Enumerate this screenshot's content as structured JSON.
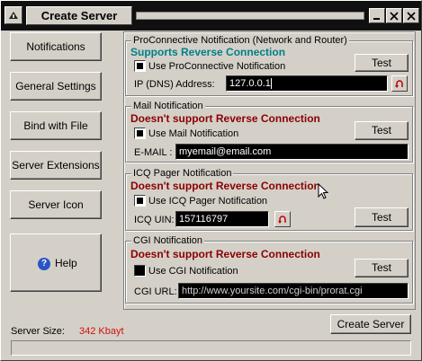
{
  "window": {
    "title": "Create Server"
  },
  "nav": {
    "notifications": "Notifications",
    "general_settings": "General Settings",
    "bind_with_file": "Bind with File",
    "server_extensions": "Server Extensions",
    "server_icon": "Server Icon",
    "help": "Help"
  },
  "proconnective": {
    "group_label": "ProConnective Notification (Network and Router)",
    "status": "Supports Reverse Connection",
    "checkbox_label": "Use ProConnective Notification",
    "checked": true,
    "field_label": "IP (DNS) Address:",
    "field_value": "127.0.0.1",
    "test_label": "Test"
  },
  "mail": {
    "group_label": "Mail Notification",
    "status": "Doesn't support Reverse Connection",
    "checkbox_label": "Use Mail Notification",
    "checked": true,
    "field_label": "E-MAIL :",
    "field_value": "myemail@email.com",
    "test_label": "Test"
  },
  "icq": {
    "group_label": "ICQ Pager Notification",
    "status": "Doesn't support Reverse Connection",
    "checkbox_label": "Use ICQ Pager Notification",
    "checked": true,
    "field_label": "ICQ UIN:",
    "field_value": "157116797",
    "test_label": "Test"
  },
  "cgi": {
    "group_label": "CGI Notification",
    "status": "Doesn't support Reverse Connection",
    "checkbox_label": "Use CGI Notification",
    "checked": false,
    "field_label": "CGI URL:",
    "field_value": "http://www.yoursite.com/cgi-bin/prorat.cgi",
    "test_label": "Test"
  },
  "footer": {
    "server_size_label": "Server Size:",
    "server_size_value": "342 Kbayt",
    "create_server_label": "Create Server",
    "progress": 0
  },
  "colors": {
    "supports": "#00808a",
    "not_supported": "#8b0000",
    "server_size": "#d01010"
  }
}
